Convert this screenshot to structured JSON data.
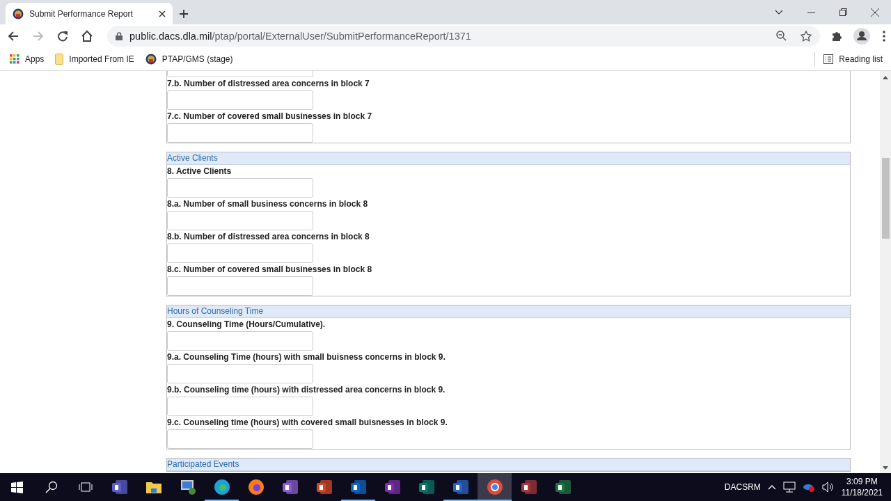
{
  "browser": {
    "tab": {
      "title": "Submit Performance Report"
    },
    "url": {
      "host": "public.dacs.dla.mil",
      "path": "/ptap/portal/ExternalUser/SubmitPerformanceReport/1371"
    },
    "bookmarks": [
      {
        "label": "Apps",
        "kind": "apps"
      },
      {
        "label": "Imported From IE",
        "kind": "folder"
      },
      {
        "label": "PTAP/GMS (stage)",
        "kind": "site"
      }
    ],
    "reading_list": "Reading list"
  },
  "sections": [
    {
      "leading_field": true,
      "questions": [
        {
          "label": "7.b. Number of distressed area concerns in block 7"
        },
        {
          "label": "7.c. Number of covered small businesses in block 7"
        }
      ]
    },
    {
      "title": "Active Clients",
      "questions": [
        {
          "label": "8. Active Clients"
        },
        {
          "label": "8.a. Number of small business concerns in block 8"
        },
        {
          "label": "8.b. Number of distressed area concerns in block 8"
        },
        {
          "label": "8.c. Number of covered small businesses in block 8"
        }
      ]
    },
    {
      "title": "Hours of Counseling Time",
      "questions": [
        {
          "label": "9. Counseling Time (Hours/Cumulative)."
        },
        {
          "label": "9.a. Counseling Time (hours) with small buisness concerns in block 9."
        },
        {
          "label": "9.b. Counseling time (hours) with distressed area concerns in block 9."
        },
        {
          "label": "9.c. Counseling time (hours) with covered small buisnesses in block 9."
        }
      ]
    },
    {
      "title": "Participated Events"
    }
  ],
  "taskbar": {
    "apps": [
      {
        "kind": "teams",
        "running": false,
        "selected": false
      },
      {
        "kind": "explorer",
        "running": false,
        "selected": false
      },
      {
        "kind": "remote",
        "running": false,
        "selected": false
      },
      {
        "kind": "edge",
        "running": true,
        "selected": false
      },
      {
        "kind": "firefox",
        "running": false,
        "selected": false
      },
      {
        "kind": "studio",
        "running": false,
        "selected": false
      },
      {
        "kind": "powerpoint",
        "running": false,
        "selected": false
      },
      {
        "kind": "outlook",
        "running": true,
        "selected": false
      },
      {
        "kind": "onenote",
        "running": false,
        "selected": false
      },
      {
        "kind": "publisher",
        "running": false,
        "selected": false
      },
      {
        "kind": "word",
        "running": true,
        "selected": false
      },
      {
        "kind": "chrome",
        "running": true,
        "selected": true
      },
      {
        "kind": "access",
        "running": false,
        "selected": false
      },
      {
        "kind": "excel",
        "running": false,
        "selected": false
      }
    ],
    "tray": {
      "user": "DACSRM",
      "time": "3:09 PM",
      "date": "11/18/2021"
    }
  }
}
